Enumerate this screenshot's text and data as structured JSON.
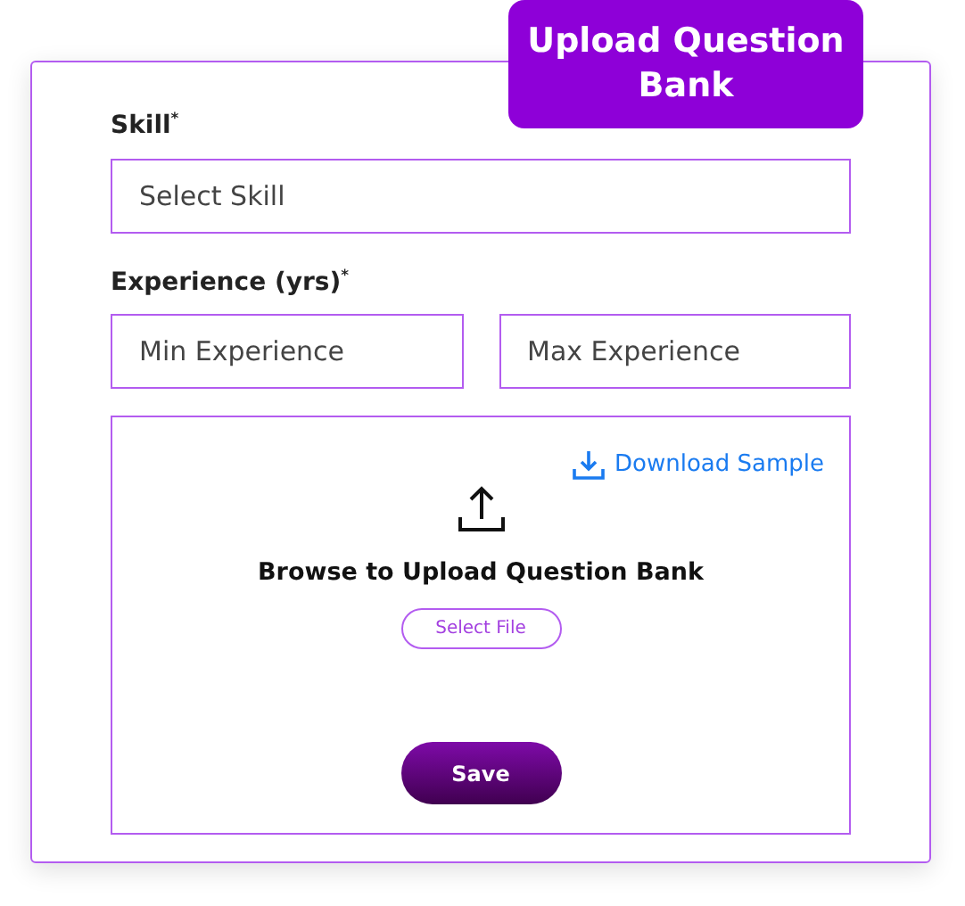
{
  "title": "Upload Question Bank",
  "skill": {
    "label": "Skill$^{*}$",
    "placeholder": "Select Skill"
  },
  "experience": {
    "label": "Experience (yrs)$^{*}$",
    "fields": [
      {
        "placeholder": "Min Experience"
      },
      {
        "placeholder": "Max Experience"
      }
    ]
  },
  "upload": {
    "download_link": "Download Sample",
    "prompt": "Browse to Upload Question Bank",
    "select_button": "Select File"
  },
  "save_button": "Save"
}
